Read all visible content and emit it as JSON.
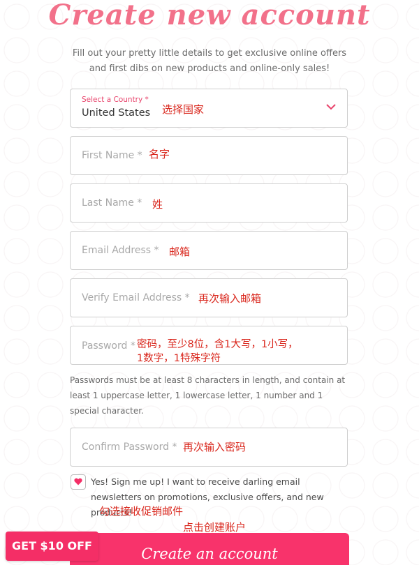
{
  "header": {
    "title": "Create new account",
    "subtitle": "Fill out your pretty little details to get exclusive online offers and first dibs on new products and online-only sales!"
  },
  "country": {
    "label": "Select a Country *",
    "value": "United States",
    "note": "选择国家"
  },
  "first_name": {
    "placeholder": "First Name *",
    "note": "名字"
  },
  "last_name": {
    "placeholder": "Last Name *",
    "note": "姓"
  },
  "email": {
    "placeholder": "Email Address *",
    "note": "邮箱"
  },
  "verify_email": {
    "placeholder": "Verify Email Address *",
    "note": "再次输入邮箱"
  },
  "password": {
    "placeholder": "Password *",
    "note_line1": "密码，至少8位，含1大写，1小写，",
    "note_line2": "1数字，1特殊字符",
    "hint": "Passwords must be at least 8 characters in length, and contain at least 1 uppercase letter, 1 lowercase letter, 1 number and 1 special character."
  },
  "confirm_password": {
    "placeholder": "Confirm Password *",
    "note": "再次输入密码"
  },
  "newsletter": {
    "checked": true,
    "icon": "heart-icon",
    "label": "Yes! Sign me up! I want to receive darling email newsletters on promotions, exclusive offers, and new products!",
    "note": "勾选接收促销邮件"
  },
  "submit": {
    "label": "Create an account",
    "note": "点击创建账户"
  },
  "promo": {
    "label": "GET $10 OFF"
  },
  "colors": {
    "accent": "#f8336b",
    "title": "#f2718a",
    "annotation": "#d9261c"
  }
}
